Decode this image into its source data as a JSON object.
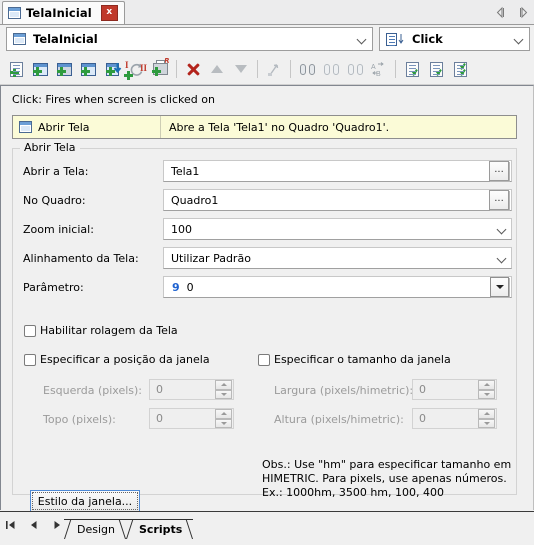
{
  "window": {
    "document_tab": {
      "label": "TelaInicial",
      "icon": "screen-window-icon",
      "close_label": "x"
    },
    "nav_prev": "◁",
    "nav_next": "▷"
  },
  "selectors": {
    "screen": {
      "value": "TelaInicial",
      "icon": "screen-window-icon"
    },
    "event": {
      "value": "Click",
      "icon": "event-script-icon"
    }
  },
  "toolbar": {
    "buttons": [
      {
        "name": "new-script-button",
        "icon": "document-add-icon"
      },
      {
        "name": "new-screen-script-button",
        "icon": "screen-add-icon"
      },
      {
        "name": "new-image-script-button",
        "icon": "image-add-icon"
      },
      {
        "name": "new-window-script-button",
        "icon": "window-add-icon"
      },
      {
        "name": "import-script-button",
        "icon": "import-down-icon"
      },
      {
        "name": "refresh-script-button",
        "icon": "refresh-icon"
      },
      {
        "name": "print-script-button",
        "icon": "printer-add-icon"
      },
      {
        "name": "delete-button",
        "icon": "delete-x-icon"
      },
      {
        "name": "move-up-button",
        "icon": "arrow-up-icon"
      },
      {
        "name": "move-down-button",
        "icon": "arrow-down-icon"
      },
      {
        "name": "branch-button",
        "icon": "branch-icon"
      },
      {
        "name": "find-button",
        "icon": "binoculars-icon"
      },
      {
        "name": "find-previous-button",
        "icon": "binoculars-prev-icon"
      },
      {
        "name": "find-next-button",
        "icon": "binoculars-next-icon"
      },
      {
        "name": "replace-button",
        "icon": "replace-ab-icon"
      },
      {
        "name": "validate-script-button",
        "icon": "document-check-icon"
      },
      {
        "name": "validate-all-button",
        "icon": "document-check-2-icon"
      },
      {
        "name": "validate-project-button",
        "icon": "document-check-3-icon"
      }
    ]
  },
  "content": {
    "hint": "Click: Fires when screen is clicked on",
    "action_row": {
      "icon": "screen-window-icon",
      "name": "Abrir Tela",
      "description": "Abre a Tela 'Tela1' no Quadro 'Quadro1'."
    },
    "group_title": "Abrir Tela",
    "fields": [
      {
        "label": "Abrir a Tela:",
        "value": "Tela1",
        "control": "text-browse",
        "button": "..."
      },
      {
        "label": "No Quadro:",
        "value": "Quadro1",
        "control": "text-browse",
        "button": "..."
      },
      {
        "label": "Zoom inicial:",
        "value": "100",
        "control": "combobox"
      },
      {
        "label": "Alinhamento da Tela:",
        "value": "Utilizar Padrão",
        "control": "combobox"
      },
      {
        "label": "Parâmetro:",
        "value": "0",
        "prefix": "9",
        "control": "dropdown"
      }
    ],
    "checkboxes": {
      "scroll": {
        "label": "Habilitar rolagem da Tela",
        "checked": false
      },
      "position": {
        "label": "Especificar a posição da janela",
        "checked": false
      },
      "size": {
        "label": "Especificar o tamanho da janela",
        "checked": false
      }
    },
    "spinners": [
      {
        "label": "Esquerda (pixels):",
        "value": "0",
        "enabled": false
      },
      {
        "label": "Topo (pixels):",
        "value": "0",
        "enabled": false
      },
      {
        "label": "Largura (pixels/himetric):",
        "value": "0",
        "enabled": false
      },
      {
        "label": "Altura (pixels/himetric):",
        "value": "0",
        "enabled": false
      }
    ],
    "obs_line1": "Obs.: Use \"hm\" para especificar tamanho em",
    "obs_line2": "HIMETRIC. Para pixels, use apenas números.",
    "obs_line3": "Ex.: 1000hm, 3500 hm, 100, 400",
    "style_button": "Estilo da janela..."
  },
  "bottom": {
    "nav": [
      "⏮",
      "◀",
      "▶",
      "⏭"
    ],
    "tabs": [
      {
        "label": "Design",
        "active": false
      },
      {
        "label": "Scripts",
        "active": true
      }
    ]
  },
  "colors": {
    "accent_blue": "#1e62d0",
    "highlight_yellow": "#fbfbd7",
    "delete_red": "#b3241c",
    "close_red": "#c0392b"
  }
}
